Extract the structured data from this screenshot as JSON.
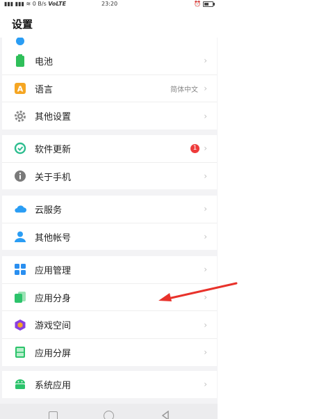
{
  "status_bar": {
    "signal": "⚫⚫⚫⚫ ⚫⚫⚫⚫",
    "network_speed": "0 B/s",
    "network_type": "VoLTE",
    "time": "23:20"
  },
  "header": {
    "title": "设置"
  },
  "groups": [
    {
      "items": [
        {
          "label": "电池",
          "icon": "battery-icon",
          "color": "#2fbf5a"
        },
        {
          "label": "语言",
          "icon": "language-icon",
          "color": "#f5a623",
          "value": "简体中文"
        },
        {
          "label": "其他设置",
          "icon": "gear-icon",
          "color": "#8a8a8a"
        }
      ]
    },
    {
      "items": [
        {
          "label": "软件更新",
          "icon": "update-icon",
          "color": "#2dbd8f",
          "badge": "1"
        },
        {
          "label": "关于手机",
          "icon": "info-icon",
          "color": "#7a7a7a"
        }
      ]
    },
    {
      "items": [
        {
          "label": "云服务",
          "icon": "cloud-icon",
          "color": "#2a9df4"
        },
        {
          "label": "其他帐号",
          "icon": "account-icon",
          "color": "#2a9df4"
        }
      ]
    },
    {
      "items": [
        {
          "label": "应用管理",
          "icon": "apps-grid-icon",
          "color": "#2a8ff0"
        },
        {
          "label": "应用分身",
          "icon": "app-clone-icon",
          "color": "#2cc36b"
        },
        {
          "label": "游戏空间",
          "icon": "game-space-icon",
          "color": "#8a3fe0"
        },
        {
          "label": "应用分屏",
          "icon": "split-screen-icon",
          "color": "#2cc36b"
        }
      ]
    },
    {
      "items": [
        {
          "label": "系统应用",
          "icon": "android-icon",
          "color": "#2cc36b"
        }
      ]
    }
  ],
  "annotation": {
    "arrow_color": "#e8322b"
  }
}
